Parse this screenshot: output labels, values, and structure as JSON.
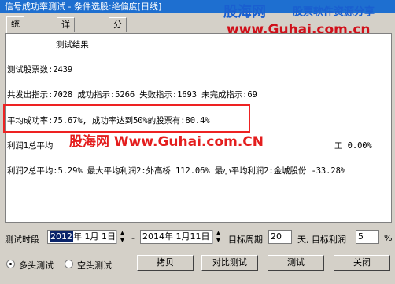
{
  "window": {
    "title": "信号成功率测试 - 条件选股:绝偏度[日线]"
  },
  "watermark": {
    "logo": "股海网",
    "slogan": "股票软件资源分享",
    "url": "www.Guhai.com.cn",
    "overlay": "股海网 Www.Guhai.com.CN"
  },
  "tabs": [
    {
      "label": "统计数据"
    },
    {
      "label": "详细列表"
    },
    {
      "label": "分布图"
    }
  ],
  "results": {
    "heading": "测试结果",
    "stock_count": "测试股票数:2439",
    "signals": "共发出指示:7028 成功指示:5266 失败指示:1693 未完成指示:69",
    "avg_success": "平均成功率:75.67%, 成功率达到50%的股票有:80.4%",
    "profit1": "利润1总平均",
    "profit1_tail": "工  0.00%",
    "profit2": "利润2总平均:5.29% 最大平均利润2:外高桥     112.06% 最小平均利润2:金城股份  -33.28%"
  },
  "controls": {
    "period_label": "测试时段",
    "start_date_year": "2012",
    "start_date_rest": "年  1月  1日",
    "dash": "-",
    "end_date": "2014年  1月11日",
    "target_period_label": "目标周期",
    "target_period_value": "20",
    "target_profit_label": "天, 目标利润",
    "target_profit_value": "5",
    "percent": "%",
    "radio_long": "多头测试",
    "radio_short": "空头测试"
  },
  "buttons": {
    "copy": "拷贝",
    "compare": "对比测试",
    "test": "测试",
    "close": "关闭"
  }
}
